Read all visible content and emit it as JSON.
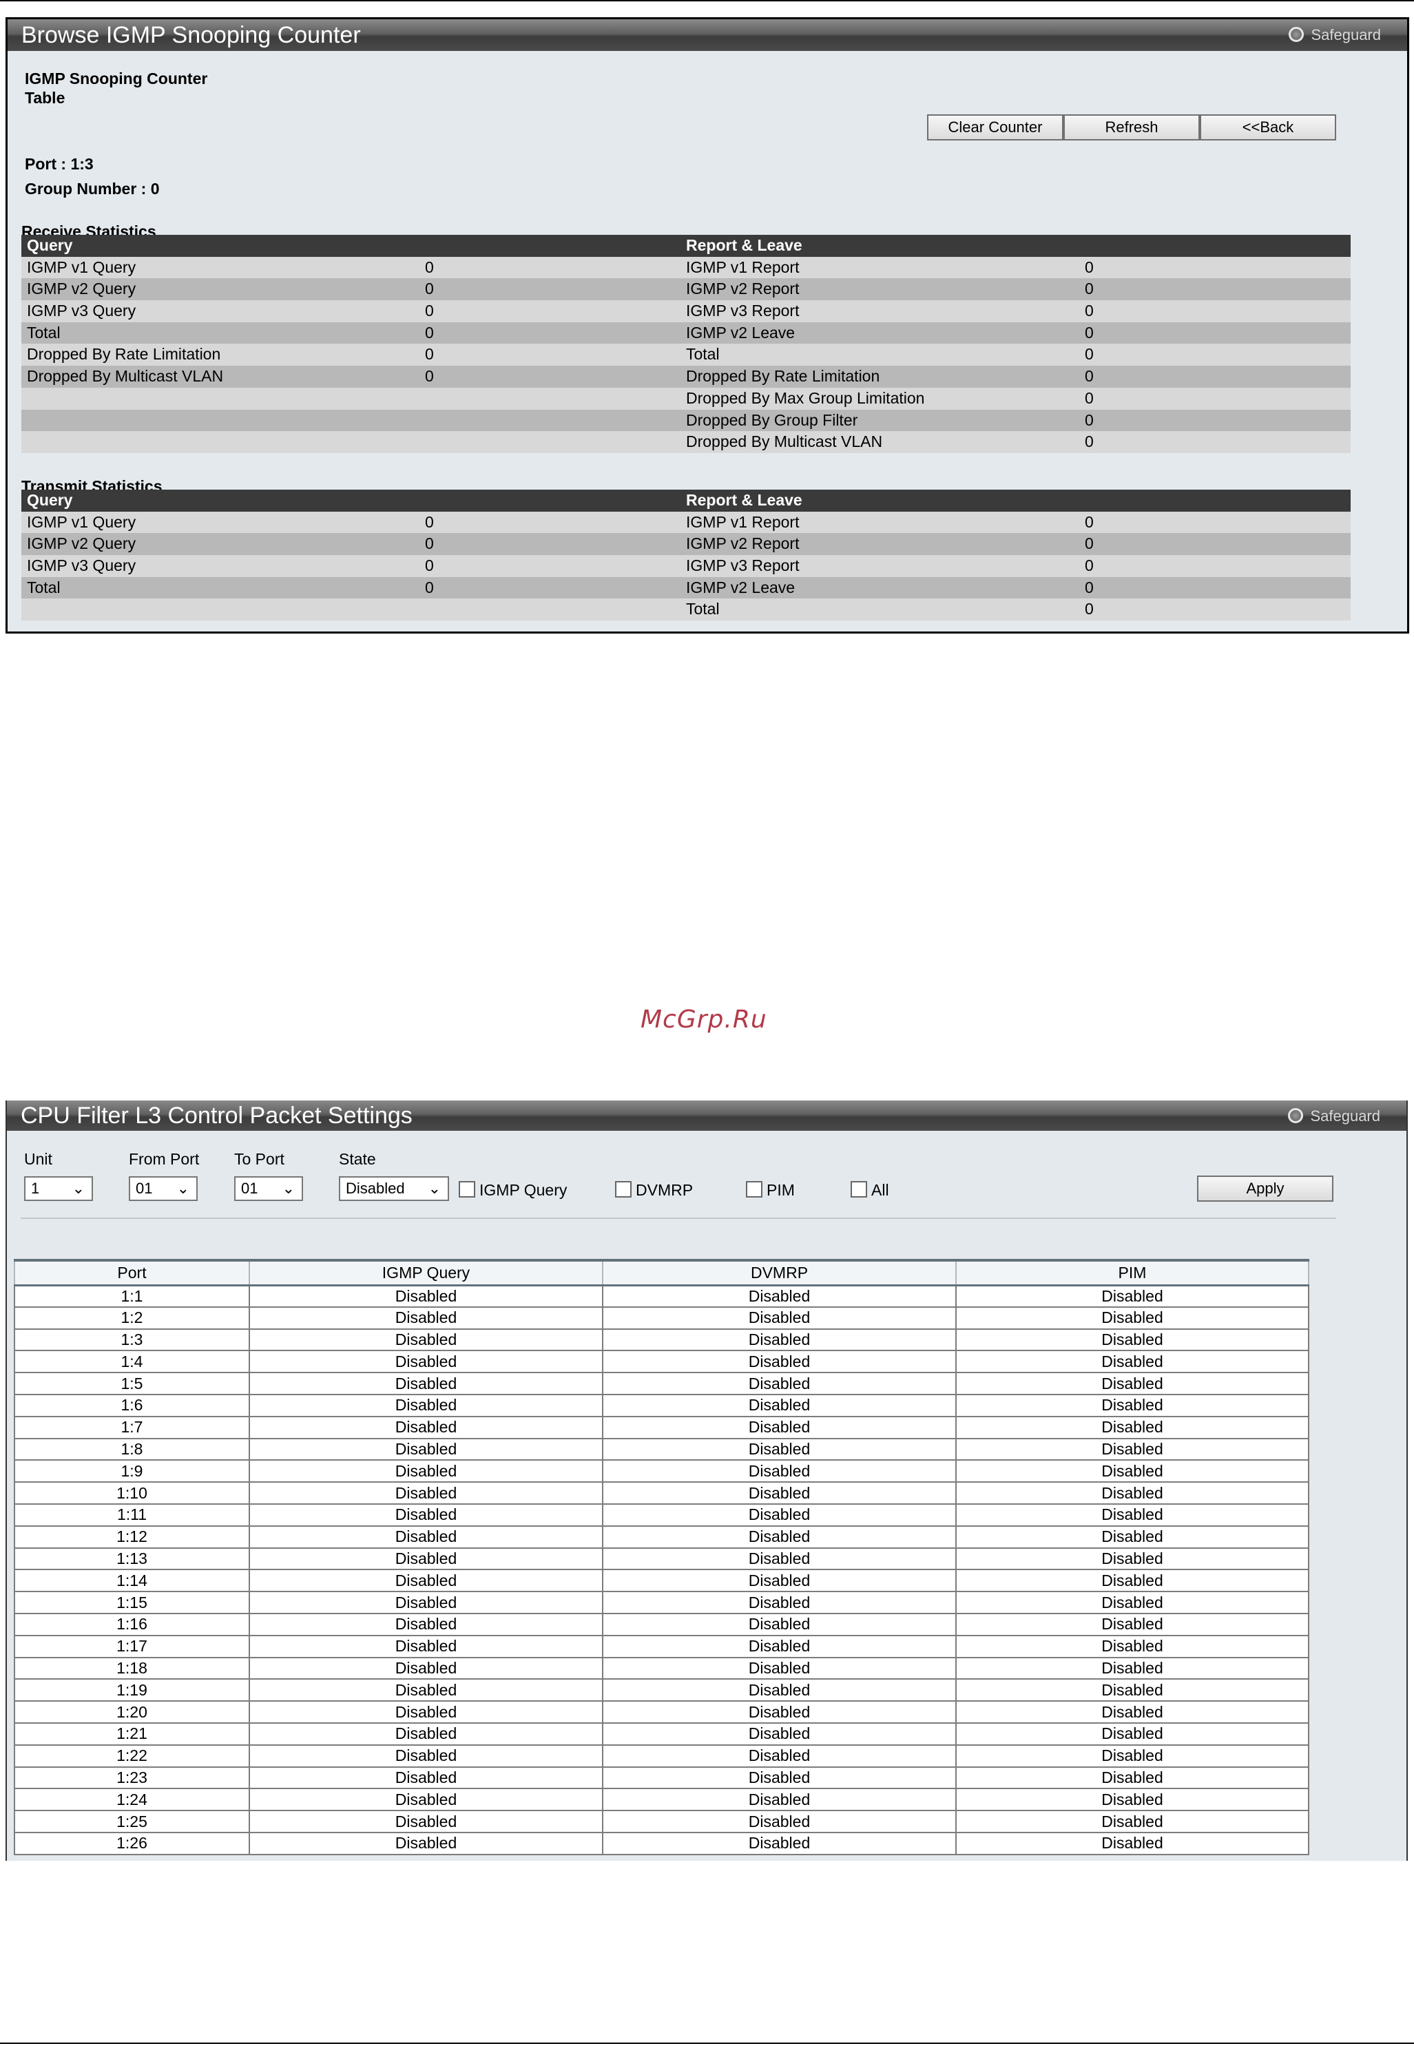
{
  "igmp": {
    "title": "Browse IGMP Snooping Counter",
    "safeguard": "Safeguard",
    "table_title_line1": "IGMP Snooping Counter",
    "table_title_line2": "Table",
    "buttons": {
      "clear": "Clear Counter",
      "refresh": "Refresh",
      "back": "<<Back"
    },
    "port_line": "Port : 1:3",
    "group_line": "Group Number : 0",
    "receive": {
      "label": "Receive Statistics",
      "header": [
        "Query",
        "Report & Leave"
      ],
      "rows": [
        [
          "IGMP v1 Query",
          "0",
          "IGMP v1 Report",
          "0"
        ],
        [
          "IGMP v2 Query",
          "0",
          "IGMP v2 Report",
          "0"
        ],
        [
          "IGMP v3 Query",
          "0",
          "IGMP v3 Report",
          "0"
        ],
        [
          "Total",
          "0",
          "IGMP v2 Leave",
          "0"
        ],
        [
          "Dropped By Rate Limitation",
          "0",
          "Total",
          "0"
        ],
        [
          "Dropped By Multicast VLAN",
          "0",
          "Dropped By Rate Limitation",
          "0"
        ],
        [
          "",
          "",
          "Dropped By Max Group Limitation",
          "0"
        ],
        [
          "",
          "",
          "Dropped By Group Filter",
          "0"
        ],
        [
          "",
          "",
          "Dropped By Multicast VLAN",
          "0"
        ]
      ]
    },
    "transmit": {
      "label": "Transmit Statistics",
      "header": [
        "Query",
        "Report & Leave"
      ],
      "rows": [
        [
          "IGMP v1 Query",
          "0",
          "IGMP v1 Report",
          "0"
        ],
        [
          "IGMP v2 Query",
          "0",
          "IGMP v2 Report",
          "0"
        ],
        [
          "IGMP v3 Query",
          "0",
          "IGMP v3 Report",
          "0"
        ],
        [
          "Total",
          "0",
          "IGMP v2 Leave",
          "0"
        ],
        [
          "",
          "",
          "Total",
          "0"
        ]
      ]
    }
  },
  "watermark": "McGrp.Ru",
  "cpu": {
    "title": "CPU Filter L3 Control Packet Settings",
    "safeguard": "Safeguard",
    "form": {
      "unit_label": "Unit",
      "unit_value": "1",
      "from_label": "From Port",
      "from_value": "01",
      "to_label": "To Port",
      "to_value": "01",
      "state_label": "State",
      "state_value": "Disabled",
      "cb_igmp": "IGMP Query",
      "cb_dvmrp": "DVMRP",
      "cb_pim": "PIM",
      "cb_all": "All",
      "apply": "Apply"
    },
    "table": {
      "columns": [
        "Port",
        "IGMP Query",
        "DVMRP",
        "PIM"
      ],
      "rows": [
        [
          "1:1",
          "Disabled",
          "Disabled",
          "Disabled"
        ],
        [
          "1:2",
          "Disabled",
          "Disabled",
          "Disabled"
        ],
        [
          "1:3",
          "Disabled",
          "Disabled",
          "Disabled"
        ],
        [
          "1:4",
          "Disabled",
          "Disabled",
          "Disabled"
        ],
        [
          "1:5",
          "Disabled",
          "Disabled",
          "Disabled"
        ],
        [
          "1:6",
          "Disabled",
          "Disabled",
          "Disabled"
        ],
        [
          "1:7",
          "Disabled",
          "Disabled",
          "Disabled"
        ],
        [
          "1:8",
          "Disabled",
          "Disabled",
          "Disabled"
        ],
        [
          "1:9",
          "Disabled",
          "Disabled",
          "Disabled"
        ],
        [
          "1:10",
          "Disabled",
          "Disabled",
          "Disabled"
        ],
        [
          "1:11",
          "Disabled",
          "Disabled",
          "Disabled"
        ],
        [
          "1:12",
          "Disabled",
          "Disabled",
          "Disabled"
        ],
        [
          "1:13",
          "Disabled",
          "Disabled",
          "Disabled"
        ],
        [
          "1:14",
          "Disabled",
          "Disabled",
          "Disabled"
        ],
        [
          "1:15",
          "Disabled",
          "Disabled",
          "Disabled"
        ],
        [
          "1:16",
          "Disabled",
          "Disabled",
          "Disabled"
        ],
        [
          "1:17",
          "Disabled",
          "Disabled",
          "Disabled"
        ],
        [
          "1:18",
          "Disabled",
          "Disabled",
          "Disabled"
        ],
        [
          "1:19",
          "Disabled",
          "Disabled",
          "Disabled"
        ],
        [
          "1:20",
          "Disabled",
          "Disabled",
          "Disabled"
        ],
        [
          "1:21",
          "Disabled",
          "Disabled",
          "Disabled"
        ],
        [
          "1:22",
          "Disabled",
          "Disabled",
          "Disabled"
        ],
        [
          "1:23",
          "Disabled",
          "Disabled",
          "Disabled"
        ],
        [
          "1:24",
          "Disabled",
          "Disabled",
          "Disabled"
        ],
        [
          "1:25",
          "Disabled",
          "Disabled",
          "Disabled"
        ],
        [
          "1:26",
          "Disabled",
          "Disabled",
          "Disabled"
        ]
      ]
    }
  }
}
